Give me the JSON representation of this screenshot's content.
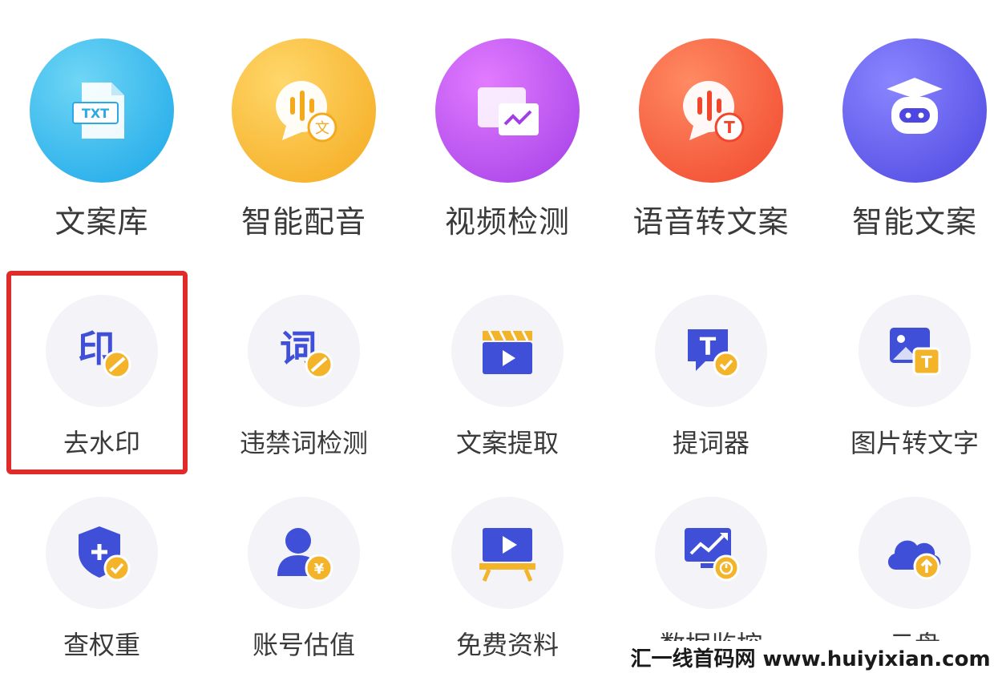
{
  "row1": [
    {
      "label": "文案库",
      "icon": "txt-document-icon",
      "badge": "TXT"
    },
    {
      "label": "智能配音",
      "icon": "voice-dubbing-icon",
      "badge": "文"
    },
    {
      "label": "视频检测",
      "icon": "video-check-icon"
    },
    {
      "label": "语音转文案",
      "icon": "speech-to-text-icon",
      "badge": "T"
    },
    {
      "label": "智能文案",
      "icon": "robot-graduate-icon"
    }
  ],
  "row2": [
    {
      "label": "去水印",
      "icon": "remove-watermark-icon",
      "glyph": "印"
    },
    {
      "label": "违禁词检测",
      "icon": "banned-word-icon",
      "glyph": "词"
    },
    {
      "label": "文案提取",
      "icon": "clapperboard-icon"
    },
    {
      "label": "提词器",
      "icon": "teleprompter-icon",
      "badge": "T"
    },
    {
      "label": "图片转文字",
      "icon": "image-to-text-icon",
      "badge": "T"
    }
  ],
  "row3": [
    {
      "label": "查权重",
      "icon": "shield-check-icon"
    },
    {
      "label": "账号估值",
      "icon": "account-value-icon",
      "badge": "¥"
    },
    {
      "label": "免费资料",
      "icon": "video-board-icon"
    },
    {
      "label": "数据监控",
      "icon": "data-monitor-icon"
    },
    {
      "label": "云盘",
      "icon": "cloud-drive-icon"
    }
  ],
  "watermark": {
    "text": "汇一线首码网 www.huiyixian.com"
  },
  "colors": {
    "highlight": "#e02b2b",
    "icon_blue": "#3f4fd8",
    "badge_yellow": "#f3b42a",
    "tile_bg": "#f3f3f8"
  }
}
